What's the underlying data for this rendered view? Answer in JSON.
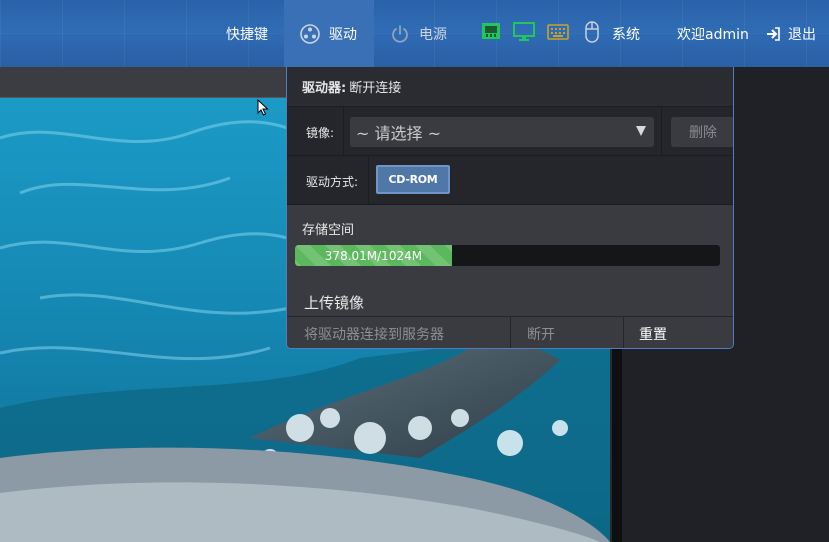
{
  "topbar": {
    "shortcuts_label": "快捷键",
    "drive_label": "驱动",
    "power_label": "电源",
    "system_label": "系统",
    "welcome_label": "欢迎admin",
    "logout_label": "退出",
    "icons": [
      "drive-icon",
      "power-icon",
      "network-icon",
      "monitor-icon",
      "keyboard-icon",
      "mouse-icon",
      "logout-icon"
    ],
    "colors": {
      "bar": "#2f6cb5",
      "active": "#3a71b6",
      "status_green": "#22c55e",
      "keyboard_gold": "#c9a227"
    }
  },
  "drive_panel": {
    "status_label": "驱动器:",
    "status_value": "断开连接",
    "image_label": "镜像:",
    "image_select_value": "~ 请选择 ~",
    "delete_button": "删除",
    "mode_label": "驱动方式:",
    "mode_button": "CD-ROM",
    "storage_title": "存储空间",
    "storage_text": "378.01M/1024M",
    "storage_used_mb": 378.01,
    "storage_total_mb": 1024,
    "upload_title": "上传镜像",
    "connect_button": "将驱动器连接到服务器",
    "disconnect_button": "断开",
    "reset_button": "重置"
  }
}
